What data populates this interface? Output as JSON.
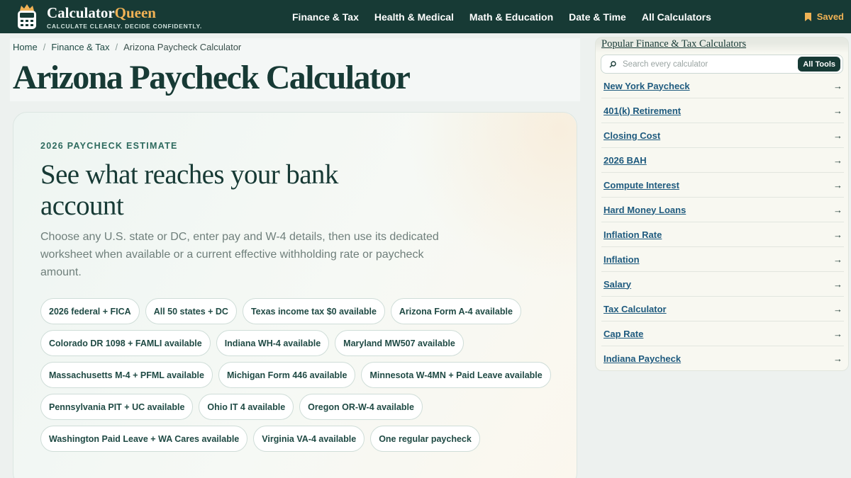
{
  "header": {
    "brand_main": "Calculator",
    "brand_accent": "Queen",
    "tagline": "CALCULATE CLEARLY. DECIDE CONFIDENTLY.",
    "nav": [
      {
        "label": "Finance & Tax"
      },
      {
        "label": "Health & Medical"
      },
      {
        "label": "Math & Education"
      },
      {
        "label": "Date & Time"
      },
      {
        "label": "All Calculators"
      }
    ],
    "saved_label": "Saved",
    "accent_color": "#f0b255",
    "bar_color": "#173a35"
  },
  "breadcrumb": {
    "home": "Home",
    "section": "Finance & Tax",
    "current": "Arizona Paycheck Calculator"
  },
  "page_title": "Arizona Paycheck Calculator",
  "hero": {
    "eyebrow": "2026 PAYCHECK ESTIMATE",
    "heading": "See what reaches your bank account",
    "description": "Choose any U.S. state or DC, enter pay and W-4 details, then use its dedicated worksheet when available or a current effective withholding rate or paycheck amount.",
    "chips": [
      {
        "label": "2026 federal + FICA"
      },
      {
        "label": "All 50 states + DC"
      },
      {
        "label": "Texas income tax $0 available"
      },
      {
        "label": "Arizona Form A-4 available"
      },
      {
        "label": "Colorado DR 1098 + FAMLI available"
      },
      {
        "label": "Indiana WH-4 available"
      },
      {
        "label": "Maryland MW507 available"
      },
      {
        "label": "Massachusetts M-4 + PFML available"
      },
      {
        "label": "Michigan Form 446 available"
      },
      {
        "label": "Minnesota W-4MN + Paid Leave available"
      },
      {
        "label": "Pennsylvania PIT + UC available"
      },
      {
        "label": "Ohio IT 4 available"
      },
      {
        "label": "Oregon OR-W-4 available"
      },
      {
        "label": "Washington Paid Leave + WA Cares available"
      },
      {
        "label": "Virginia VA-4 available"
      },
      {
        "label": "One regular paycheck"
      }
    ]
  },
  "sidebar": {
    "title": "Popular Finance & Tax Calculators",
    "search_placeholder": "Search every calculator",
    "all_tools_label": "All Tools",
    "arrow": "→",
    "links": [
      {
        "label": "New York Paycheck"
      },
      {
        "label": "401(k) Retirement"
      },
      {
        "label": "Closing Cost"
      },
      {
        "label": "2026 BAH"
      },
      {
        "label": "Compute Interest"
      },
      {
        "label": "Hard Money Loans"
      },
      {
        "label": "Inflation Rate"
      },
      {
        "label": "Inflation"
      },
      {
        "label": "Salary"
      },
      {
        "label": "Tax Calculator"
      },
      {
        "label": "Cap Rate"
      },
      {
        "label": "Indiana Paycheck"
      }
    ]
  }
}
